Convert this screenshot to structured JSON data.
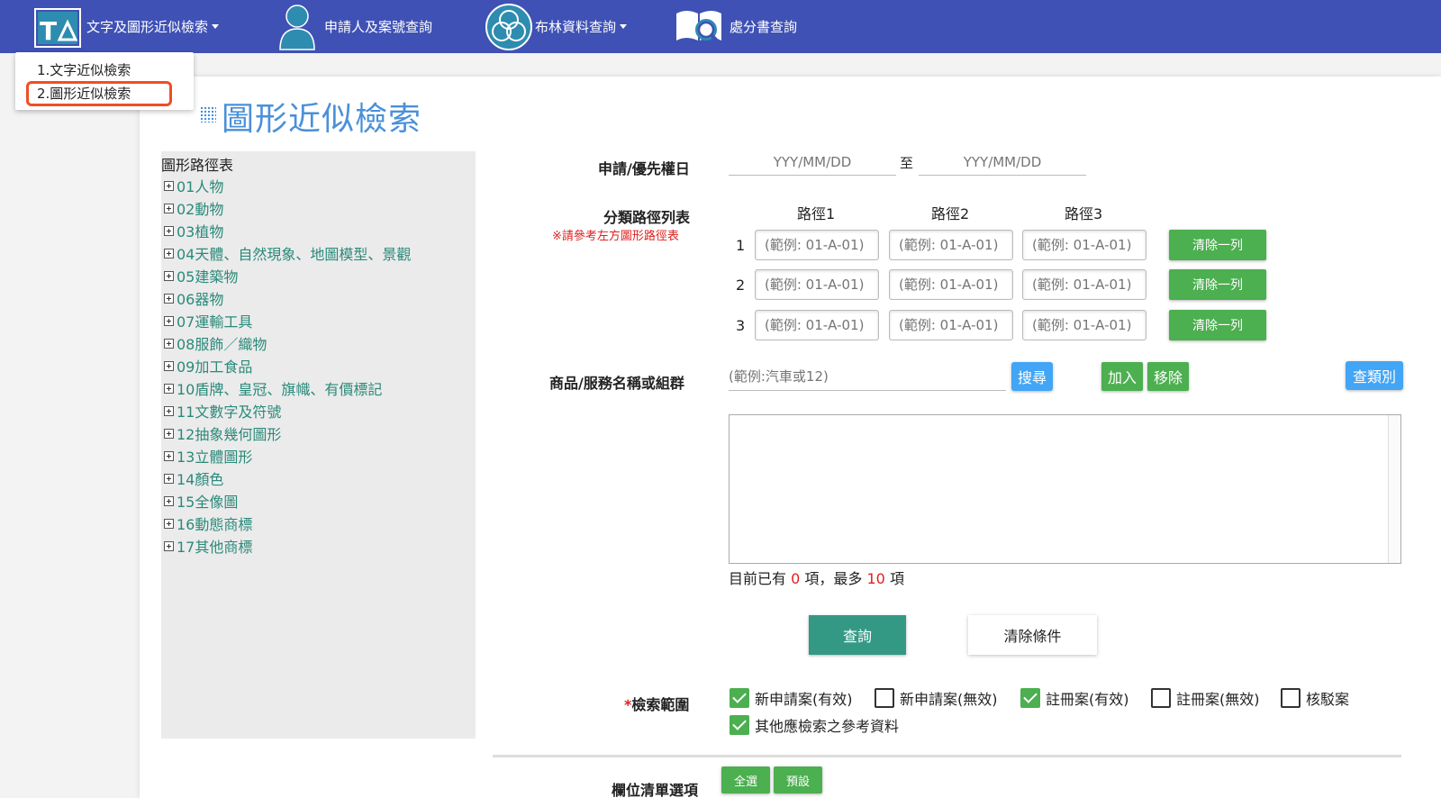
{
  "nav": {
    "item1": {
      "label": "文字及圖形近似檢索",
      "icon": "text-graphic-search-icon"
    },
    "item2": {
      "label": "申請人及案號查詢",
      "icon": "person-icon"
    },
    "item3": {
      "label": "布林資料查詢",
      "icon": "boolean-venn-icon"
    },
    "item4": {
      "label": "處分書查詢",
      "icon": "book-search-icon"
    }
  },
  "dropdown": {
    "items": [
      "1.文字近似檢索",
      "2.圖形近似檢索"
    ],
    "highlight_color": "#f04e22"
  },
  "page_title": "圖形近似檢索",
  "tree": {
    "title": "圖形路徑表",
    "items": [
      "01人物",
      "02動物",
      "03植物",
      "04天體、自然現象、地圖模型、景觀",
      "05建築物",
      "06器物",
      "07運輸工具",
      "08服飾／織物",
      "09加工食品",
      "10盾牌、皇冠、旗幟、有價標記",
      "11文數字及符號",
      "12抽象幾何圖形",
      "13立體圖形",
      "14顏色",
      "15全像圖",
      "16動態商標",
      "17其他商標"
    ]
  },
  "form": {
    "date_label": "申請/優先權日",
    "date_from_placeholder": "YYY/MM/DD",
    "date_to_text": "至",
    "date_to_placeholder": "YYY/MM/DD",
    "path_label": "分類路徑列表",
    "path_note": "※請參考左方圖形路徑表",
    "path_headers": [
      "路徑1",
      "路徑2",
      "路徑3"
    ],
    "path_rows": [
      "1",
      "2",
      "3"
    ],
    "path_placeholder": "(範例: 01-A-01)",
    "clear_row_label": "清除一列",
    "goods_label": "商品/服務名稱或組群",
    "goods_placeholder": "(範例:汽車或12)",
    "search_btn": "搜尋",
    "add_btn": "加入",
    "remove_btn": "移除",
    "class_btn": "查類別",
    "count_prefix": "目前已有",
    "count_current": "0",
    "count_mid": "項，最多",
    "count_max": "10",
    "count_suffix": "項",
    "query_btn": "查詢",
    "clear_btn": "清除條件",
    "scope_required_mark": "*",
    "scope_label": "檢索範圍",
    "scope_options": [
      {
        "label": "新申請案(有效)",
        "checked": true
      },
      {
        "label": "新申請案(無效)",
        "checked": false
      },
      {
        "label": "註冊案(有效)",
        "checked": true
      },
      {
        "label": "註冊案(無效)",
        "checked": false
      },
      {
        "label": "核駁案",
        "checked": false
      },
      {
        "label": "其他應檢索之參考資料",
        "checked": true
      }
    ],
    "fields_label": "欄位清單選項",
    "select_all_btn": "全選",
    "default_btn": "預設"
  },
  "colors": {
    "nav_bg": "#3f51b5",
    "title": "#4a90d9",
    "tree_link": "#2a8a7a",
    "green_btn": "#4caf50",
    "blue_btn": "#42a5f5",
    "query_btn": "#339985",
    "red": "#e02020"
  }
}
